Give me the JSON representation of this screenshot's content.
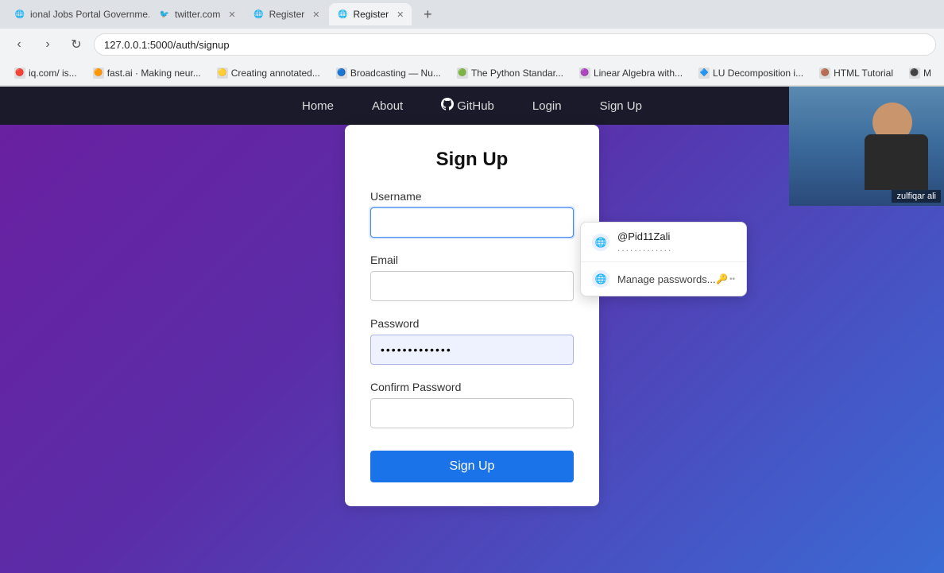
{
  "browser": {
    "tabs": [
      {
        "id": "tab1",
        "label": "ional Jobs Portal Governme...",
        "favicon": "🌐",
        "active": false,
        "closeable": true
      },
      {
        "id": "tab2",
        "label": "twitter.com",
        "favicon": "🐦",
        "active": false,
        "closeable": true
      },
      {
        "id": "tab3",
        "label": "Register",
        "favicon": "🌐",
        "active": false,
        "closeable": true
      },
      {
        "id": "tab4",
        "label": "Register",
        "favicon": "🌐",
        "active": true,
        "closeable": true
      }
    ],
    "url": "127.0.0.1:5000/auth/signup",
    "bookmarks": [
      {
        "label": "iq.com/ is...",
        "favicon": "🔴"
      },
      {
        "label": "fast.ai · Making neur...",
        "favicon": "🟠"
      },
      {
        "label": "Creating annotated...",
        "favicon": "🟡"
      },
      {
        "label": "Broadcasting — Nu...",
        "favicon": "🔵"
      },
      {
        "label": "The Python Standar...",
        "favicon": "🟢"
      },
      {
        "label": "Linear Algebra with...",
        "favicon": "🟣"
      },
      {
        "label": "LU Decomposition i...",
        "favicon": "🔷"
      },
      {
        "label": "HTML Tutorial",
        "favicon": "🟤"
      },
      {
        "label": "M",
        "favicon": "⚫"
      }
    ]
  },
  "navbar": {
    "links": [
      {
        "label": "Home",
        "id": "home"
      },
      {
        "label": "About",
        "id": "about"
      },
      {
        "label": "GitHub",
        "id": "github",
        "hasIcon": true
      },
      {
        "label": "Login",
        "id": "login"
      },
      {
        "label": "Sign Up",
        "id": "signup"
      }
    ]
  },
  "form": {
    "title": "Sign Up",
    "username_label": "Username",
    "username_placeholder": "",
    "email_label": "Email",
    "email_placeholder": "",
    "password_label": "Password",
    "password_placeholder": "",
    "password_value": ".............",
    "confirm_password_label": "Confirm Password",
    "confirm_placeholder": "",
    "submit_label": "Sign Up"
  },
  "autocomplete": {
    "account_name": "@Pid11Zali",
    "account_password": ".............",
    "manage_label": "Manage passwords...",
    "key_icon": "🔑"
  },
  "webcam": {
    "name": "zulfiqar ali"
  }
}
